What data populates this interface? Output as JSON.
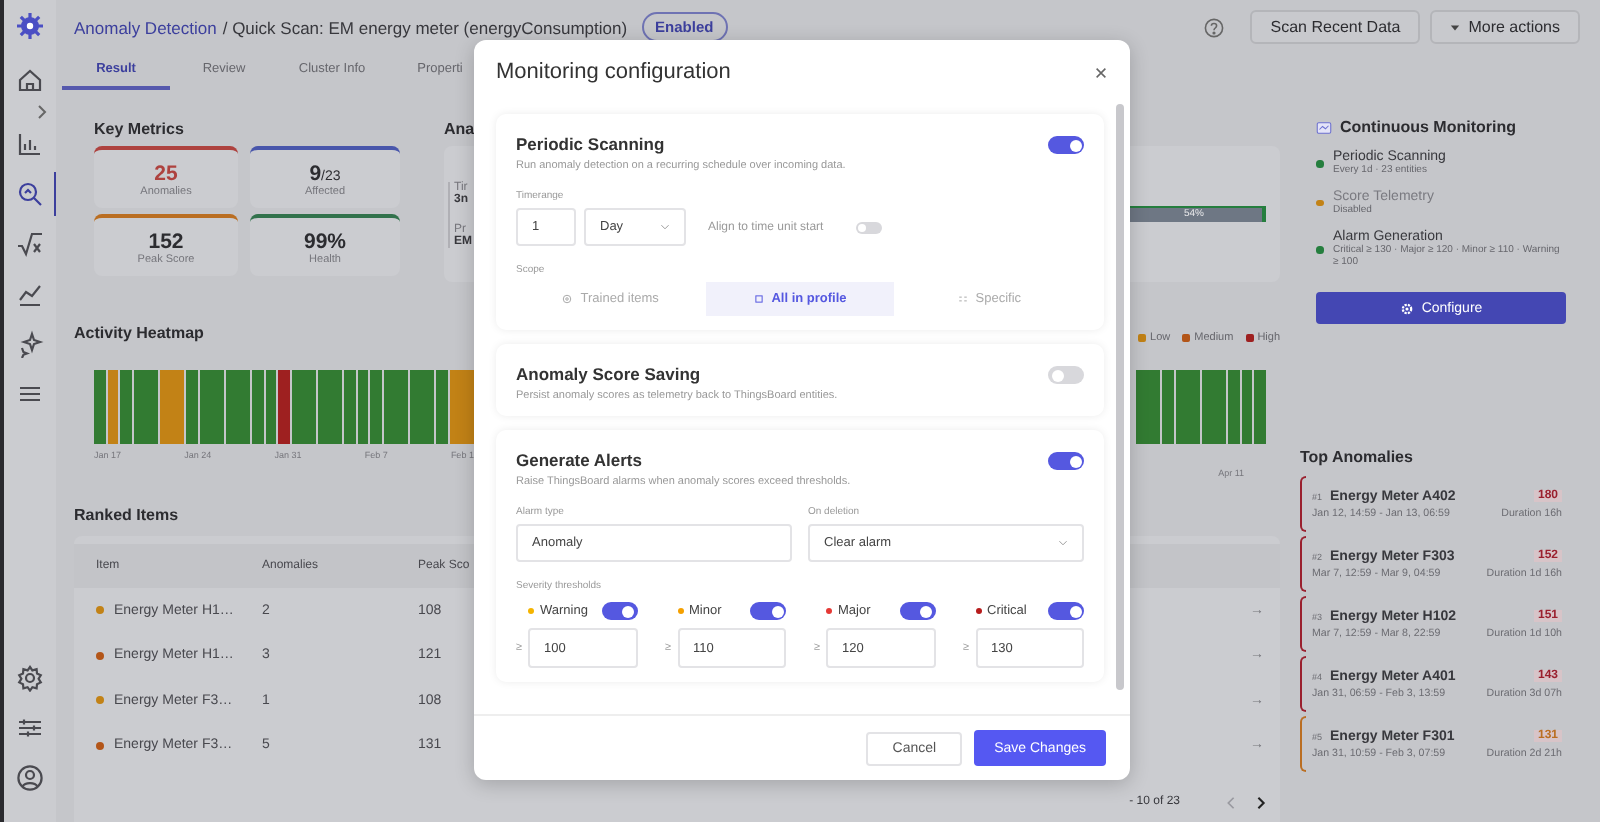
{
  "header": {
    "breadcrumb_link": "Anomaly Detection",
    "title": "/ Quick Scan: EM energy meter (energyConsumption)",
    "status": "Enabled",
    "buttons": [
      {
        "label": "Scan Recent Data",
        "kind": "plain"
      },
      {
        "label": "More actions",
        "kind": "menu"
      }
    ]
  },
  "sidebar": {
    "items": [
      {
        "selected": false
      },
      {
        "selected": false
      },
      {
        "selected": true
      },
      {
        "selected": false
      },
      {
        "selected": false
      },
      {
        "selected": false
      },
      {
        "selected": false
      }
    ]
  },
  "tabs": [
    {
      "label": "Result",
      "selected": true
    },
    {
      "label": "Review",
      "selected": false
    },
    {
      "label": "Cluster Info",
      "selected": false
    },
    {
      "label": "Properti",
      "selected": false
    }
  ],
  "key_metrics": {
    "title": "Key Metrics",
    "cards": [
      {
        "value": "25",
        "label": "Anomalies",
        "color": "#ae423f",
        "value_colored": true
      },
      {
        "value": "9",
        "total": "/23",
        "label": "Affected",
        "color": "#4956ab",
        "value_colored": false
      },
      {
        "value": "152",
        "label": "Peak Score",
        "color": "#ba6e22",
        "value_colored": false
      },
      {
        "value": "99%",
        "label": "Health",
        "color": "#32724c",
        "value_colored": false
      }
    ]
  },
  "analysis": {
    "title": "Ana",
    "fields": [
      {
        "label": "Tir",
        "value": "3n"
      },
      {
        "label": "Pr",
        "value": "EM"
      }
    ],
    "progress_label": "54%",
    "level": 0.97
  },
  "heatmap": {
    "title": "Activity Heatmap",
    "legend": [
      {
        "label": "Low",
        "color": "#c28216"
      },
      {
        "label": "Medium",
        "color": "#b35518"
      },
      {
        "label": "High",
        "color": "#9e2020"
      }
    ],
    "cells_left": [
      {
        "color": "#327b32"
      },
      {
        "color": "#c28216"
      },
      {
        "color": "#327b32"
      },
      {
        "color": "#327b32"
      },
      {
        "color": "#327b32"
      },
      {
        "color": "#c28216"
      },
      {
        "color": "#c28216"
      },
      {
        "color": "#327b32"
      },
      {
        "color": "#327b32"
      },
      {
        "color": "#327b32"
      },
      {
        "color": "#327b32"
      },
      {
        "color": "#327b32"
      },
      {
        "color": "#327b32"
      },
      {
        "color": "#327b32"
      },
      {
        "color": "#9e2020"
      },
      {
        "color": "#327b32"
      },
      {
        "color": "#327b32"
      },
      {
        "color": "#327b32"
      },
      {
        "color": "#327b32"
      },
      {
        "color": "#327b32"
      },
      {
        "color": "#327b32"
      },
      {
        "color": "#327b32"
      },
      {
        "color": "#327b32"
      },
      {
        "color": "#327b32"
      },
      {
        "color": "#327b32"
      },
      {
        "color": "#327b32"
      },
      {
        "color": "#327b32"
      },
      {
        "color": "#c28216"
      },
      {
        "color": "#c28216"
      }
    ],
    "cells_right": [
      {
        "color": "#327b32"
      },
      {
        "color": "#327b32"
      },
      {
        "color": "#327b32"
      },
      {
        "color": "#327b32"
      },
      {
        "color": "#327b32"
      },
      {
        "color": "#327b32"
      },
      {
        "color": "#327b32"
      },
      {
        "color": "#327b32"
      },
      {
        "color": "#327b32"
      },
      {
        "color": "#327b32"
      }
    ],
    "dates_left": [
      "Jan 17",
      "Jan 24",
      "Jan 31",
      "Feb 7",
      "Feb 1"
    ],
    "dates_right": [
      "Apr 11"
    ]
  },
  "ranked_items": {
    "title": "Ranked Items",
    "columns": [
      "Item",
      "Anomalies",
      "Peak Sco"
    ],
    "rows": [
      {
        "item": "Energy Meter H1…",
        "color": "#c28216",
        "anomalies": "2",
        "peak": "108",
        "action": "→"
      },
      {
        "item": "Energy Meter H1…",
        "color": "#b35518",
        "anomalies": "3",
        "peak": "121",
        "action": "→"
      },
      {
        "item": "Energy Meter F3…",
        "color": "#c28216",
        "anomalies": "1",
        "peak": "108",
        "action": "→"
      },
      {
        "item": "Energy Meter F3…",
        "color": "#b35518",
        "anomalies": "5",
        "peak": "131",
        "action": "→"
      }
    ],
    "pagination": {
      "range": "- 10 of 23",
      "prev_enabled": false,
      "next_enabled": true
    }
  },
  "monitoring": {
    "title": "Continuous Monitoring",
    "items": [
      {
        "title": "Periodic Scanning",
        "detail": "Every 1d · 23 entities",
        "color": "#257e3e",
        "active": true
      },
      {
        "title": "Score Telemetry",
        "detail": "Disabled",
        "color": "#c28216",
        "active": false
      },
      {
        "title": "Alarm Generation",
        "detail": "Critical ≥ 130 · Major ≥ 120 · Minor ≥ 110 · Warning ≥ 100",
        "color": "#257e3e",
        "active": true
      }
    ],
    "button": "Configure"
  },
  "top_anomalies": {
    "title": "Top Anomalies",
    "items": [
      {
        "rank": "#1",
        "name": "Energy Meter A402",
        "range": "Jan 12, 14:59 - Jan 13, 06:59",
        "score": "180",
        "duration": "Duration 16h",
        "color": "#9a202e"
      },
      {
        "rank": "#2",
        "name": "Energy Meter F303",
        "range": "Mar 7, 12:59 - Mar 9, 04:59",
        "score": "152",
        "duration": "Duration 1d 16h",
        "color": "#9a202e"
      },
      {
        "rank": "#3",
        "name": "Energy Meter H102",
        "range": "Mar 7, 12:59 - Mar 8, 22:59",
        "score": "151",
        "duration": "Duration 1d 10h",
        "color": "#9a202e"
      },
      {
        "rank": "#4",
        "name": "Energy Meter A401",
        "range": "Jan 31, 06:59 - Feb 3, 13:59",
        "score": "143",
        "duration": "Duration 3d 07h",
        "color": "#9a202e"
      },
      {
        "rank": "#5",
        "name": "Energy Meter F301",
        "range": "Jan 31, 10:59 - Feb 3, 07:59",
        "score": "131",
        "duration": "Duration 2d 21h",
        "color": "#ba6e22"
      }
    ]
  },
  "dialog": {
    "title": "Monitoring configuration",
    "periodic": {
      "title": "Periodic Scanning",
      "description": "Run anomaly detection on a recurring schedule over incoming data.",
      "on": true,
      "timerange_label": "Timerange",
      "count": "1",
      "unit": "Day",
      "align_label": "Align to time unit start",
      "align_on": false,
      "scope_label": "Scope",
      "scope": [
        {
          "label": "Trained items",
          "selected": false
        },
        {
          "label": "All in profile",
          "selected": true
        },
        {
          "label": "Specific",
          "selected": false
        }
      ]
    },
    "saving": {
      "title": "Anomaly Score Saving",
      "description": "Persist anomaly scores as telemetry back to ThingsBoard entities.",
      "on": false
    },
    "alerts": {
      "title": "Generate Alerts",
      "description": "Raise ThingsBoard alarms when anomaly scores exceed thresholds.",
      "on": true,
      "alarm_type_label": "Alarm type",
      "alarm_type": "Anomaly",
      "on_deletion_label": "On deletion",
      "on_deletion": "Clear alarm",
      "thresholds_label": "Severity thresholds",
      "thresholds": [
        {
          "label": "Warning",
          "color": "#f5b400",
          "on": true,
          "prefix": "≥",
          "value": "100"
        },
        {
          "label": "Minor",
          "color": "#f5a000",
          "on": true,
          "prefix": "≥",
          "value": "110"
        },
        {
          "label": "Major",
          "color": "#e53935",
          "on": true,
          "prefix": "≥",
          "value": "120"
        },
        {
          "label": "Critical",
          "color": "#b71c1c",
          "on": true,
          "prefix": "≥",
          "value": "130"
        }
      ]
    },
    "cancel": "Cancel",
    "save": "Save Changes"
  }
}
